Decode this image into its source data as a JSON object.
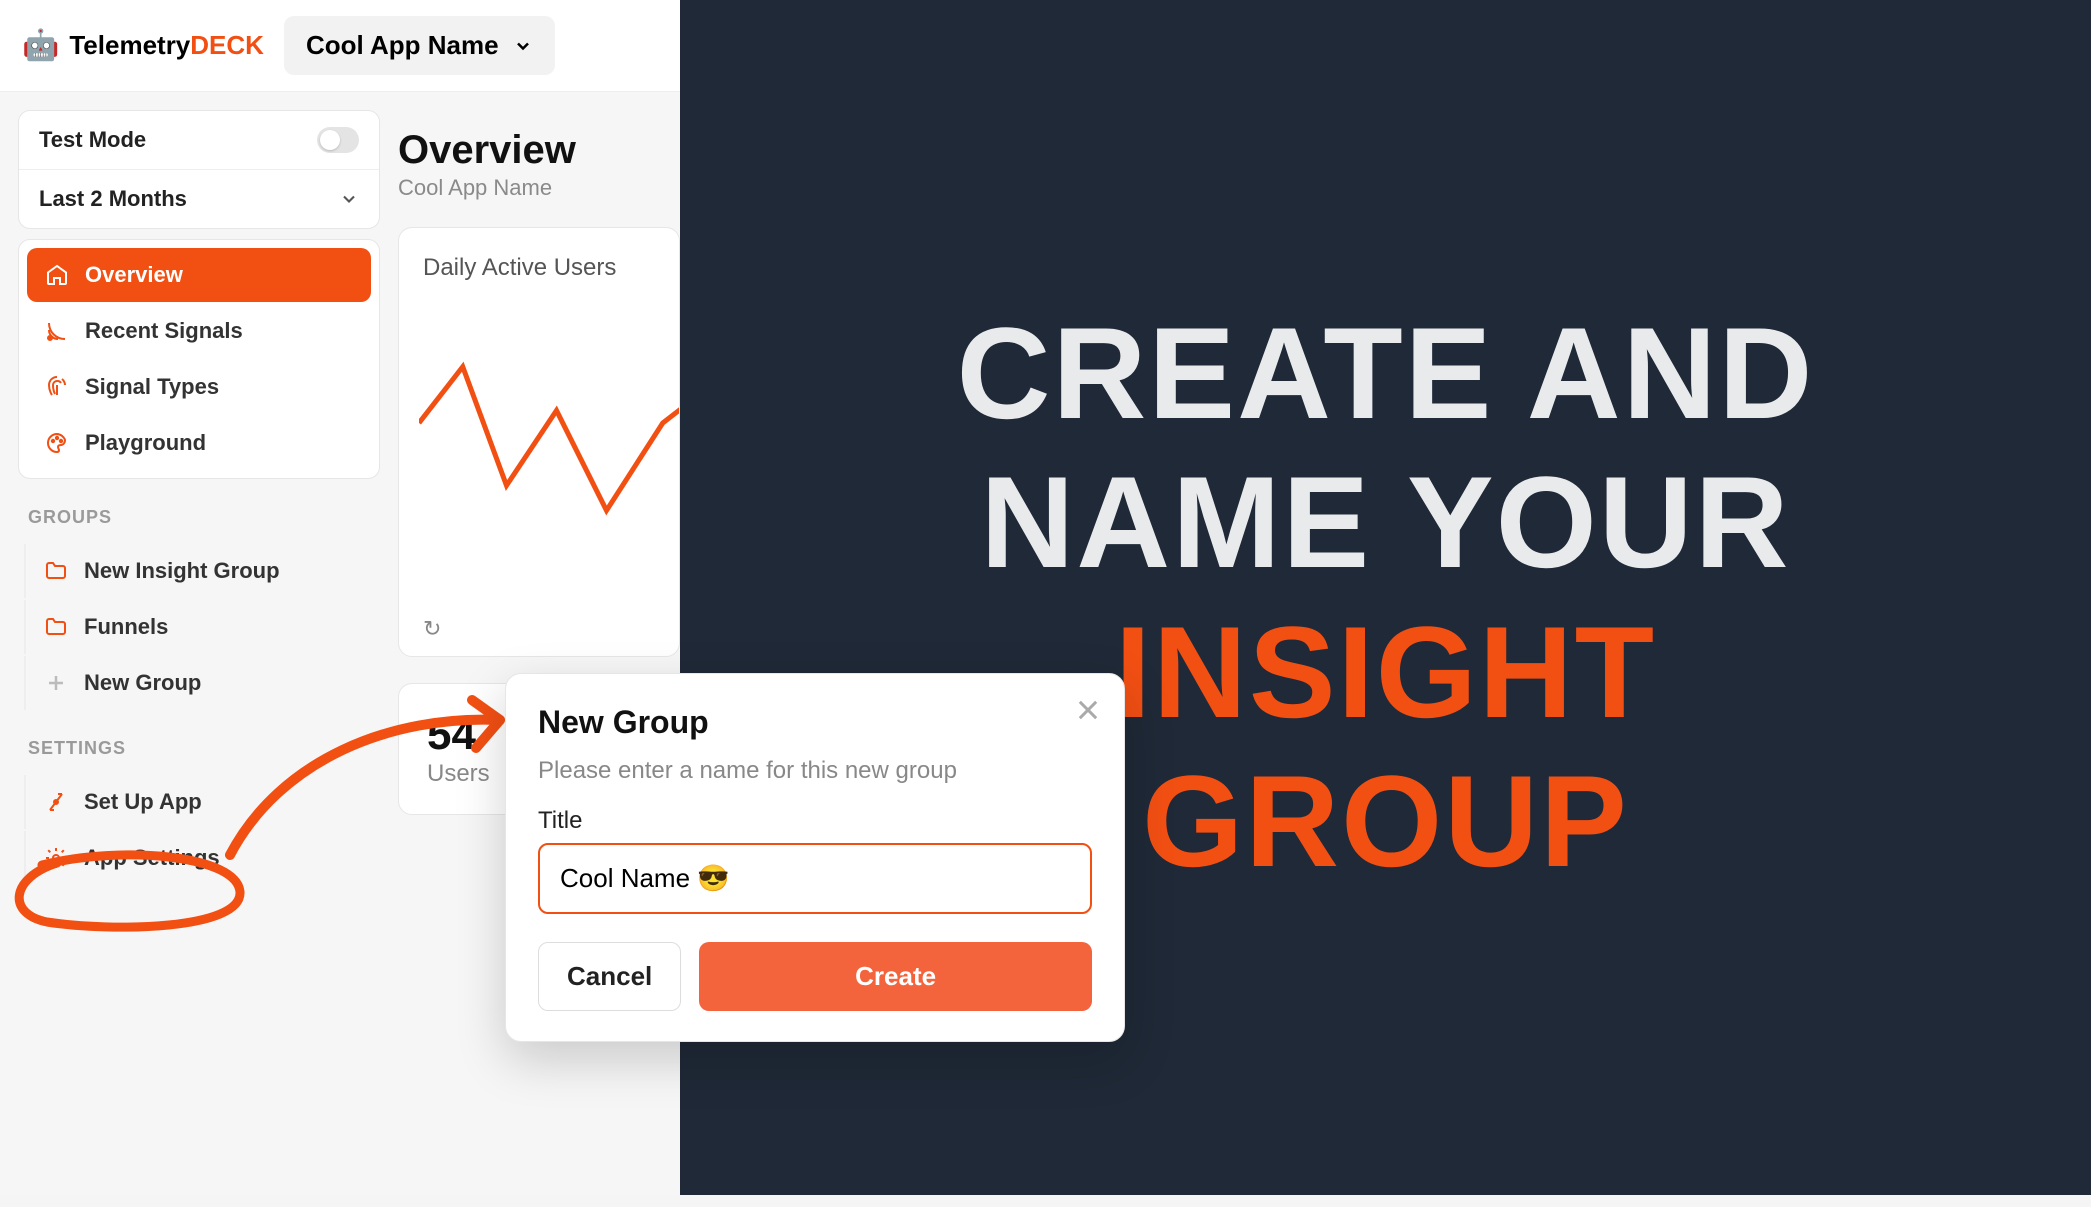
{
  "brand": {
    "name_part1": "Telemetry",
    "name_part2": "DECK"
  },
  "app_selector": {
    "value": "Cool App Name"
  },
  "filters": {
    "test_mode_label": "Test Mode",
    "date_range": "Last 2 Months"
  },
  "nav": {
    "items": [
      {
        "label": "Overview",
        "icon": "home-icon",
        "active": true
      },
      {
        "label": "Recent Signals",
        "icon": "signal-icon"
      },
      {
        "label": "Signal Types",
        "icon": "fingerprint-icon"
      },
      {
        "label": "Playground",
        "icon": "palette-icon"
      }
    ]
  },
  "groups": {
    "section_label": "GROUPS",
    "items": [
      {
        "label": "New Insight Group",
        "icon": "folder-icon"
      },
      {
        "label": "Funnels",
        "icon": "folder-icon"
      },
      {
        "label": "New Group",
        "icon": "plus-icon"
      }
    ]
  },
  "settings": {
    "section_label": "SETTINGS",
    "items": [
      {
        "label": "Set Up App",
        "icon": "setup-icon"
      },
      {
        "label": "App Settings",
        "icon": "gear-icon"
      }
    ]
  },
  "main": {
    "title": "Overview",
    "subtitle": "Cool App Name",
    "chart_title": "Daily Active Users",
    "stat_value": "54",
    "stat_label": "Users"
  },
  "modal": {
    "title": "New Group",
    "description": "Please enter a name for this new group",
    "field_label": "Title",
    "input_value": "Cool Name 😎",
    "cancel_label": "Cancel",
    "create_label": "Create"
  },
  "promo": {
    "line1": "CREATE AND",
    "line2": "NAME YOUR",
    "line3": "INSIGHT",
    "line4": "GROUP"
  }
}
